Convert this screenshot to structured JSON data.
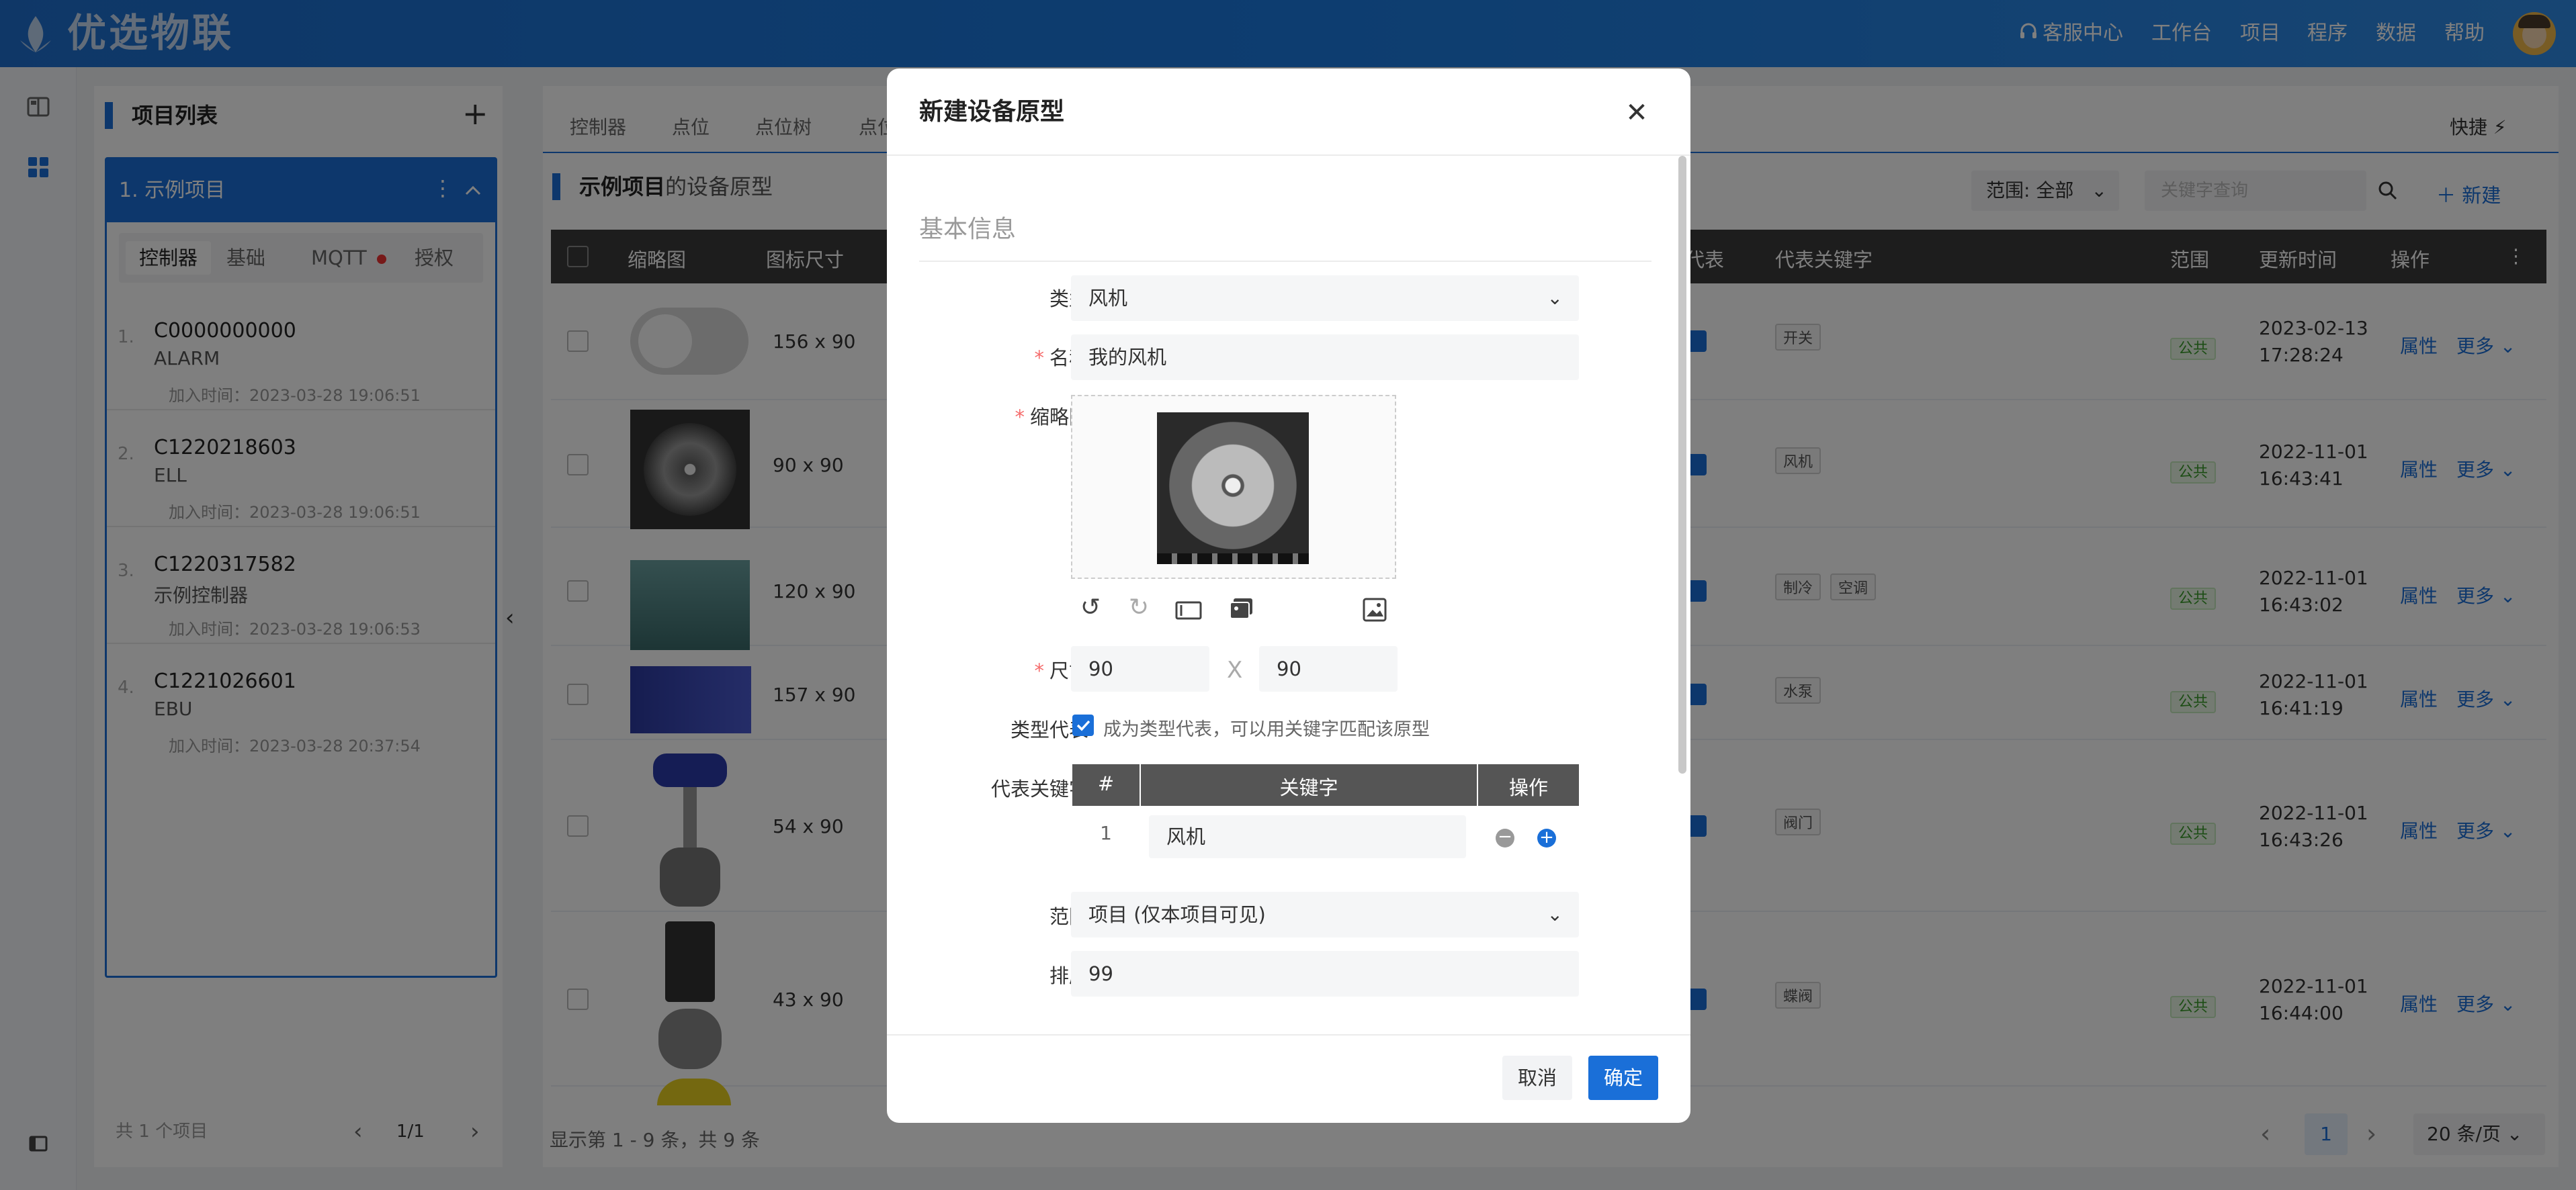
{
  "brand": {
    "name": "优选物联"
  },
  "topnav": [
    "客服中心",
    "工作台",
    "项目",
    "程序",
    "数据",
    "帮助"
  ],
  "project_panel": {
    "title": "项目列表",
    "active_project": "1. 示例项目",
    "subtabs": [
      "控制器",
      "基础",
      "MQTT",
      "授权"
    ],
    "controllers": [
      {
        "idx": "1.",
        "id": "C0000000000",
        "name": "ALARM",
        "time": "加入时间：2023-03-28 19:06:51"
      },
      {
        "idx": "2.",
        "id": "C1220218603",
        "name": "ELL",
        "time": "加入时间：2023-03-28 19:06:51"
      },
      {
        "idx": "3.",
        "id": "C1220317582",
        "name": "示例控制器",
        "time": "加入时间：2023-03-28 19:06:53"
      },
      {
        "idx": "4.",
        "id": "C1221026601",
        "name": "EBU",
        "time": "加入时间：2023-03-28 20:37:54"
      }
    ],
    "footer_count": "共 1 个项目",
    "footer_page": "1/1"
  },
  "main": {
    "tabs": [
      "控制器",
      "点位",
      "点位树",
      "点位"
    ],
    "quick": "快捷",
    "title_project": "示例项目",
    "title_suffix": "的设备原型",
    "scope_filter": "范围: 全部",
    "search_placeholder": "关键字查询",
    "new_button": "新建",
    "columns": [
      "缩略图",
      "图标尺寸",
      "代表",
      "代表关键字",
      "范围",
      "更新时间",
      "操作"
    ],
    "rows": [
      {
        "size": "156 x 90",
        "keywords": [
          "开关"
        ],
        "scope": "公共",
        "date": "2023-02-13",
        "time": "17:28:24"
      },
      {
        "size": "90 x 90",
        "keywords": [
          "风机"
        ],
        "scope": "公共",
        "date": "2022-11-01",
        "time": "16:43:41"
      },
      {
        "size": "120 x 90",
        "keywords": [
          "制冷",
          "空调"
        ],
        "scope": "公共",
        "date": "2022-11-01",
        "time": "16:43:02"
      },
      {
        "size": "157 x 90",
        "keywords": [
          "水泵"
        ],
        "scope": "公共",
        "date": "2022-11-01",
        "time": "16:41:19"
      },
      {
        "size": "54 x 90",
        "keywords": [
          "阀门"
        ],
        "scope": "公共",
        "date": "2022-11-01",
        "time": "16:43:26"
      },
      {
        "size": "43 x 90",
        "keywords": [
          "蝶阀"
        ],
        "scope": "公共",
        "date": "2022-11-01",
        "time": "16:44:00"
      }
    ],
    "action_attr": "属性",
    "action_more": "更多",
    "footer_info": "显示第 1 - 9 条，共 9 条",
    "current_page": "1",
    "page_size": "20 条/页"
  },
  "modal": {
    "title": "新建设备原型",
    "section": "基本信息",
    "labels": {
      "type": "类型",
      "name": "名称",
      "thumbnail": "缩略图",
      "size": "尺寸",
      "type_rep": "类型代表",
      "rep_keywords": "代表关键字",
      "scope": "范围",
      "order": "排序"
    },
    "type_value": "风机",
    "name_value": "我的风机",
    "width_value": "90",
    "height_value": "90",
    "size_sep": "X",
    "type_rep_text": "成为类型代表，可以用关键字匹配该原型",
    "kw_table": {
      "headers": [
        "#",
        "关键字",
        "操作"
      ],
      "rows": [
        {
          "n": "1",
          "kw": "风机"
        }
      ]
    },
    "scope_value": "项目 (仅本项目可见)",
    "order_value": "99",
    "cancel": "取消",
    "ok": "确定"
  }
}
